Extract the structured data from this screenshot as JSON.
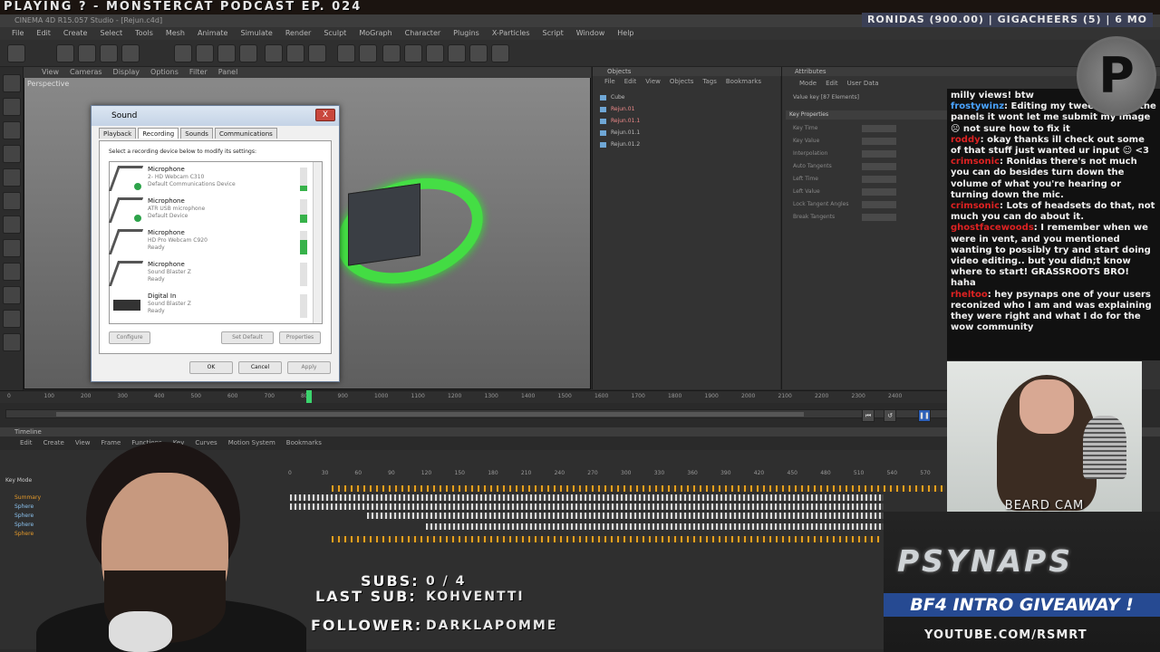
{
  "stream": {
    "title": "PLAYING ? - MONSTERCAT PODCAST EP. 024",
    "ticker": "RONIDAS (900.00) | GIGACHEERS (5) | 6 MO",
    "subs_label": "SUBS:",
    "subs_value": "0 / 4",
    "last_sub_label": "LAST SUB:",
    "last_sub_value": "KOHVENTTI",
    "follower_label": "FOLLOWER:",
    "follower_value": "DARKLAPOMME",
    "beard_cam": "BEARD CAM",
    "brand": "PSYNAPS",
    "giveaway": "BF4 INTRO GIVEAWAY !",
    "youtube": "YOUTUBE.COM/RSMRT",
    "logo_letter": "P"
  },
  "c4d": {
    "title": "CINEMA 4D R15.057 Studio - [Rejun.c4d]",
    "menu": [
      "File",
      "Edit",
      "Create",
      "Select",
      "Tools",
      "Mesh",
      "Animate",
      "Simulate",
      "Render",
      "Sculpt",
      "MoGraph",
      "Character",
      "Plugins",
      "X-Particles",
      "Script",
      "Window",
      "Help"
    ],
    "viewport_menu": [
      "View",
      "Cameras",
      "Display",
      "Options",
      "Filter",
      "Panel"
    ],
    "viewport_label": "Perspective",
    "objects_title": "Objects",
    "objects_menu": [
      "File",
      "Edit",
      "View",
      "Objects",
      "Tags",
      "Bookmarks"
    ],
    "objects": [
      "Cube",
      "Rejun.01",
      "Rejun.01.1",
      "Rejun.01.1",
      "Rejun.01.2"
    ],
    "attributes_title": "Attributes",
    "attributes_menu": [
      "Mode",
      "Edit",
      "User Data"
    ],
    "attributes_info": "Value key [87 Elements]",
    "key_section": "Key Properties",
    "key_rows": [
      "Key Time",
      "Key Value",
      "Interpolation",
      "Auto Tangents",
      "Left Time",
      "Left Value",
      "Lock Tangent Angles",
      "Break Tangents"
    ],
    "ruler_ticks": [
      "0",
      "100",
      "200",
      "300",
      "400",
      "500",
      "600",
      "700",
      "800",
      "900",
      "1000",
      "1100",
      "1200",
      "1300",
      "1400",
      "1500",
      "1600",
      "1700",
      "1800",
      "1900",
      "2000",
      "2100",
      "2200",
      "2300",
      "2400"
    ],
    "timeline_title": "Timeline",
    "timeline_menu": [
      "Edit",
      "Create",
      "View",
      "Frame",
      "Functions",
      "Key",
      "Curves",
      "Motion System",
      "Bookmarks"
    ],
    "dope_ticks": [
      "0",
      "30",
      "60",
      "90",
      "120",
      "150",
      "180",
      "210",
      "240",
      "270",
      "300",
      "330",
      "360",
      "390",
      "420",
      "450",
      "480",
      "510",
      "540",
      "570"
    ],
    "keys_title": "Key Mode",
    "tracks": [
      "Summary",
      "Sphere",
      "Sphere",
      "Sphere",
      "Sphere"
    ]
  },
  "sound_dialog": {
    "title": "Sound",
    "close": "X",
    "tabs": [
      "Playback",
      "Recording",
      "Sounds",
      "Communications"
    ],
    "instructions": "Select a recording device below to modify its settings:",
    "devices": [
      {
        "name": "Microphone",
        "sub": "2- HD Webcam C310",
        "status": "Default Communications Device",
        "level": 0.25
      },
      {
        "name": "Microphone",
        "sub": "ATR USB microphone",
        "status": "Default Device",
        "level": 0.35
      },
      {
        "name": "Microphone",
        "sub": "HD Pro Webcam C920",
        "status": "Ready",
        "level": 0.6
      },
      {
        "name": "Microphone",
        "sub": "Sound Blaster Z",
        "status": "Ready",
        "level": 0.0
      },
      {
        "name": "Digital In",
        "sub": "Sound Blaster Z",
        "status": "Ready",
        "level": 0.0
      }
    ],
    "configure": "Configure",
    "set_default": "Set Default",
    "properties": "Properties",
    "ok": "OK",
    "cancel": "Cancel",
    "apply": "Apply"
  },
  "chat": [
    {
      "user": "",
      "text": "milly views! btw"
    },
    {
      "user": "frostywinz",
      "text": "Editing my tweet and on the panels it wont let me submit my image ☹ not sure how to fix it"
    },
    {
      "user": "roddy",
      "text": "okay thanks ill check out some of that stuff just wanted ur input ☺ <3"
    },
    {
      "user": "crimsonic",
      "text": "Ronidas there's not much you can do besides turn down the volume of what you're hearing or turning down the mic."
    },
    {
      "user": "crimsonic",
      "text": "Lots of headsets do that, not much you can do about it."
    },
    {
      "user": "ghostfacewoods",
      "text": "I remember when we were in vent, and you mentioned wanting to possibly try and start doing video editing.. but you didn;t know where to start! GRASSROOTS BRO! haha"
    },
    {
      "user": "rheltoo",
      "text": "hey psynaps one of your users reconized who I am and was explaining they were right and what I do for the wow community"
    }
  ]
}
